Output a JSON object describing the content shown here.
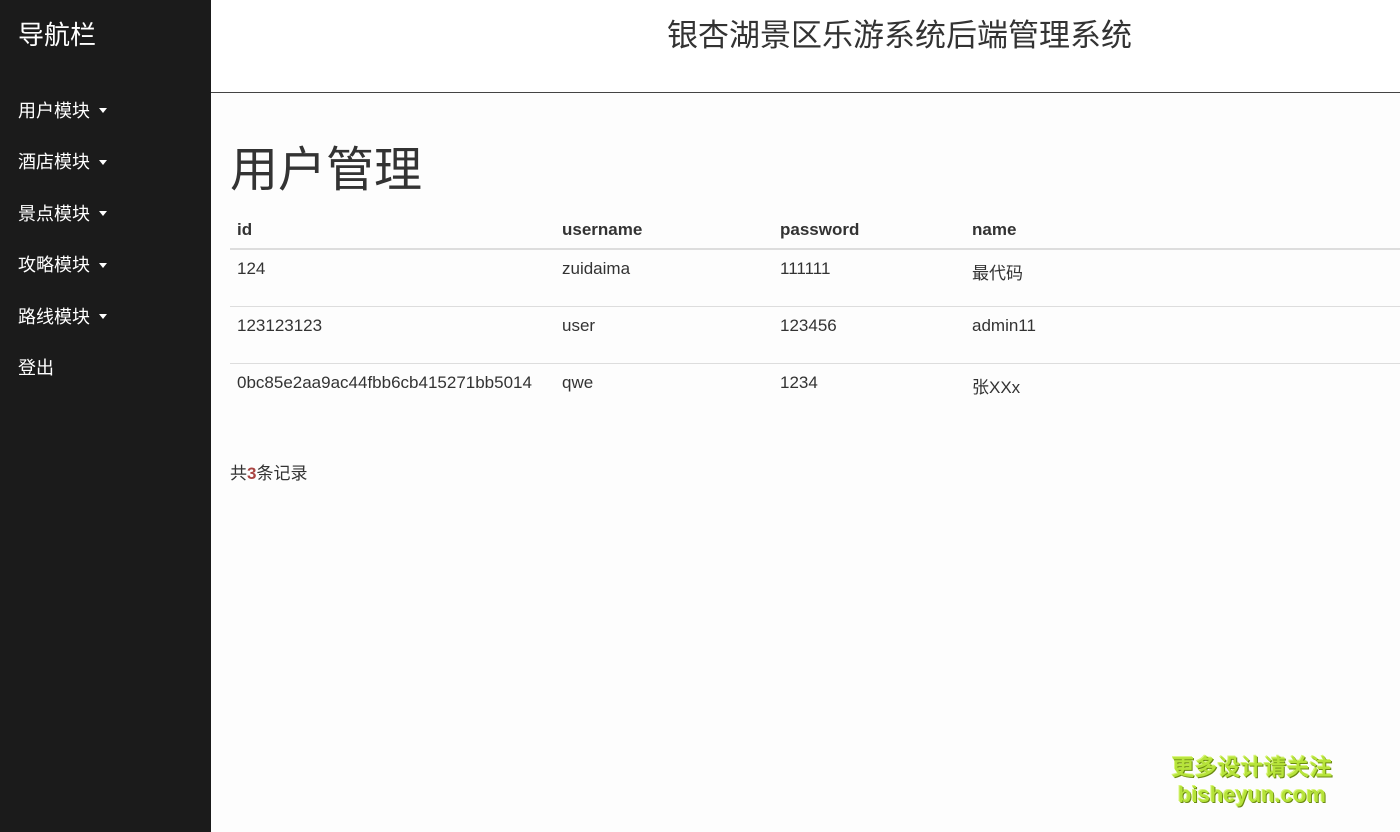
{
  "sidebar": {
    "title": "导航栏",
    "items": [
      {
        "label": "用户模块",
        "dropdown": true
      },
      {
        "label": "酒店模块",
        "dropdown": true
      },
      {
        "label": "景点模块",
        "dropdown": true
      },
      {
        "label": "攻略模块",
        "dropdown": true
      },
      {
        "label": "路线模块",
        "dropdown": true
      },
      {
        "label": "登出",
        "dropdown": false
      }
    ]
  },
  "header": {
    "title": "银杏湖景区乐游系统后端管理系统"
  },
  "main": {
    "page_title": "用户管理",
    "table": {
      "columns": [
        "id",
        "username",
        "password",
        "name"
      ],
      "rows": [
        [
          "124",
          "zuidaima",
          "111111",
          "最代码"
        ],
        [
          "123123123",
          "user",
          "123456",
          "admin11"
        ],
        [
          "0bc85e2aa9ac44fbb6cb415271bb5014",
          "qwe",
          "1234",
          "张XXx"
        ]
      ]
    },
    "record_count": {
      "prefix": "共",
      "count": "3",
      "suffix": "条记录"
    }
  },
  "watermark": {
    "line1": "更多设计请关注",
    "line2": "bisheyun.com"
  },
  "colors": {
    "sidebar_bg": "#1b1b1b",
    "count_accent": "#a94442",
    "watermark": "#b6e33a"
  }
}
